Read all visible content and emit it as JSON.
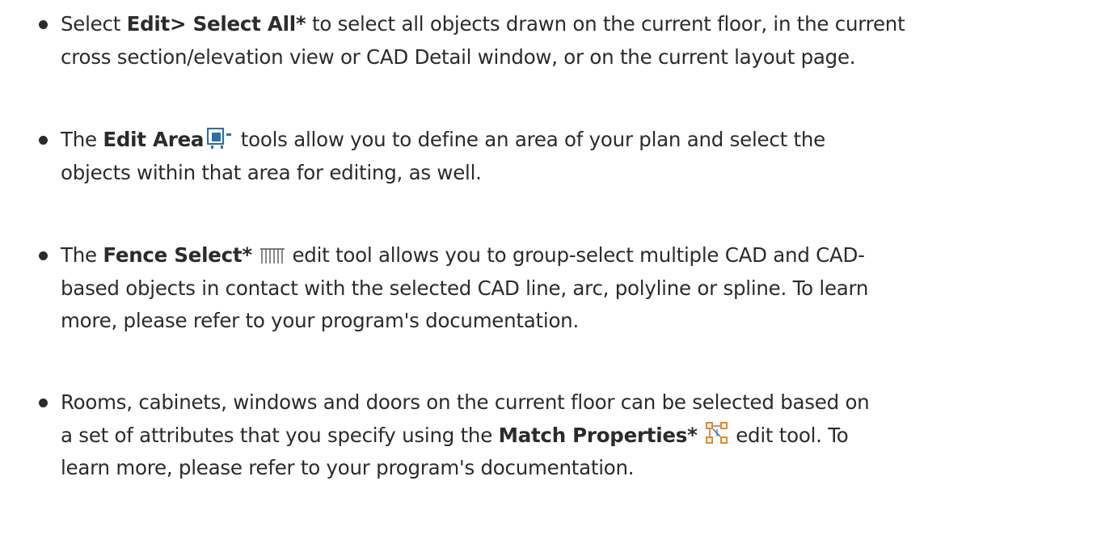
{
  "bullets": [
    {
      "line1": {
        "pre": "Select ",
        "bold": "Edit> Select All*",
        "post": " to select all objects drawn on the current floor, in the current"
      },
      "line2": "cross section/elevation view or CAD Detail window, or on the current layout page."
    },
    {
      "line1": {
        "pre": "The ",
        "bold": "Edit Area",
        "icon": "edit-area-icon",
        "post": " tools allow you to define an area of your plan and select the"
      },
      "line2": "objects within that area for editing, as well."
    },
    {
      "line1": {
        "pre": "The ",
        "bold": "Fence Select*",
        "icon": "fence-select-icon",
        "post": " edit tool allows you to group-select multiple CAD and CAD-"
      },
      "line2": "based objects in contact with the selected CAD line, arc, polyline or spline. To learn",
      "line3": "more, please refer to your program's documentation."
    },
    {
      "line1": "Rooms, cabinets, windows and doors on the current floor can be selected based on",
      "line2": {
        "pre": "a set of attributes that you specify using the ",
        "bold": "Match Properties*",
        "icon": "match-properties-icon",
        "post": " edit tool. To"
      },
      "line3": "learn more, please refer to your program's documentation."
    }
  ],
  "colors": {
    "text": "#2b2b2b",
    "icon_blue": "#2f6fa8",
    "icon_orange": "#e0892a"
  }
}
